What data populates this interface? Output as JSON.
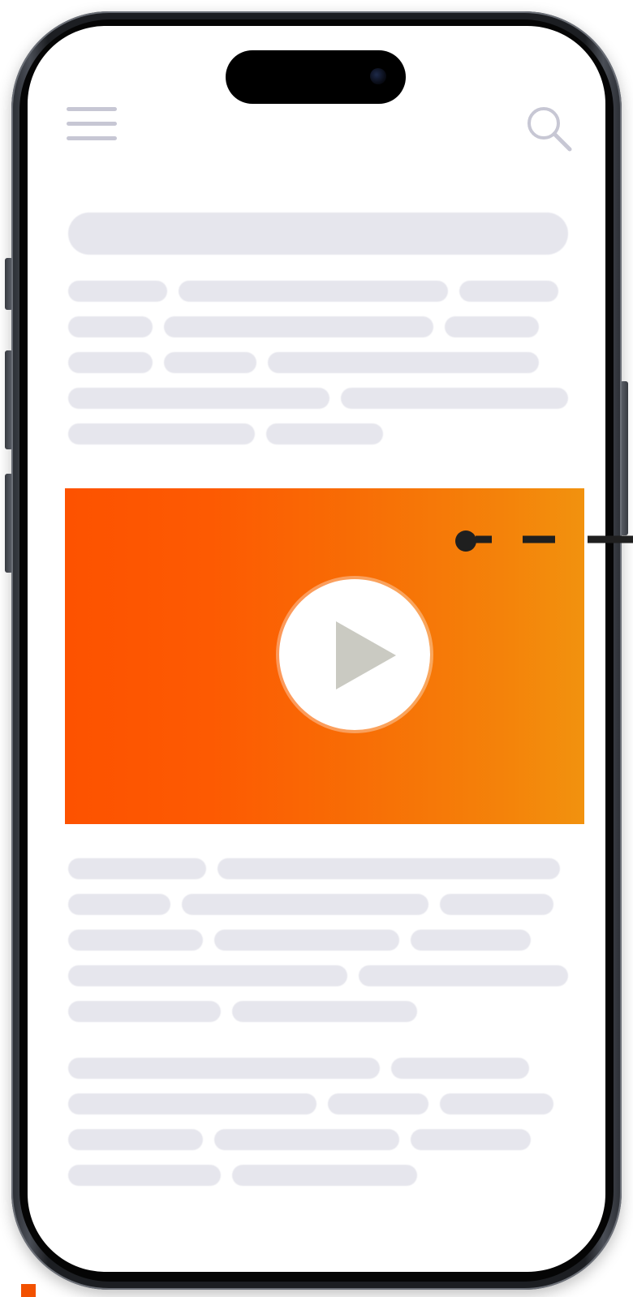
{
  "app": {
    "accent_color": "#fd5200",
    "accent_color_end": "#f2920e",
    "skeleton_color": "#e6e6ed",
    "icon_color": "#c7c7d4"
  },
  "header": {
    "menu_icon": "hamburger-menu-icon",
    "search_icon": "search-icon"
  },
  "video": {
    "play_icon": "play-icon",
    "play_triangle_color": "#cacac2"
  },
  "annotation": {
    "pointer_color": "#1f1f1f"
  }
}
